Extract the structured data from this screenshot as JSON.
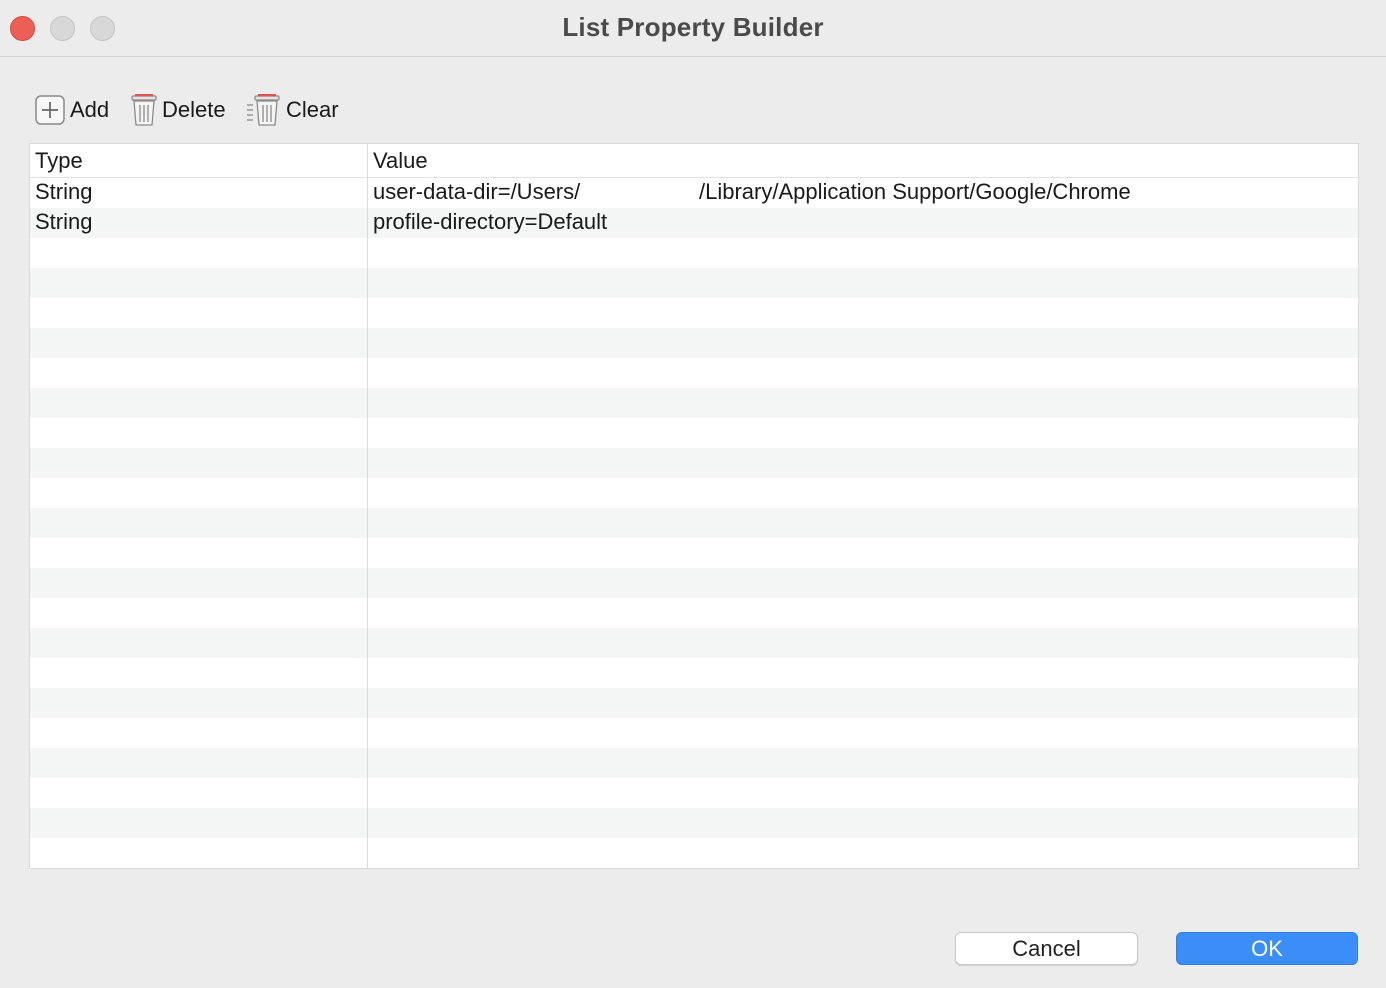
{
  "window": {
    "title": "List Property Builder"
  },
  "toolbar": {
    "add_label": "Add",
    "delete_label": "Delete",
    "clear_label": "Clear"
  },
  "table": {
    "columns": [
      "Type",
      "Value"
    ],
    "rows": [
      {
        "type": "String",
        "value": "user-data-dir=/Users/",
        "value_tail": "/Library/Application Support/Google/Chrome"
      },
      {
        "type": "String",
        "value": "profile-directory=Default",
        "value_tail": ""
      }
    ]
  },
  "buttons": {
    "cancel_label": "Cancel",
    "ok_label": "OK"
  },
  "colors": {
    "accent": "#3b8ef7",
    "close": "#ec5f57",
    "stripe": "#f4f5f5",
    "trash_lid": "#d9534f"
  },
  "icons": [
    "add-icon",
    "delete-icon",
    "clear-icon"
  ]
}
